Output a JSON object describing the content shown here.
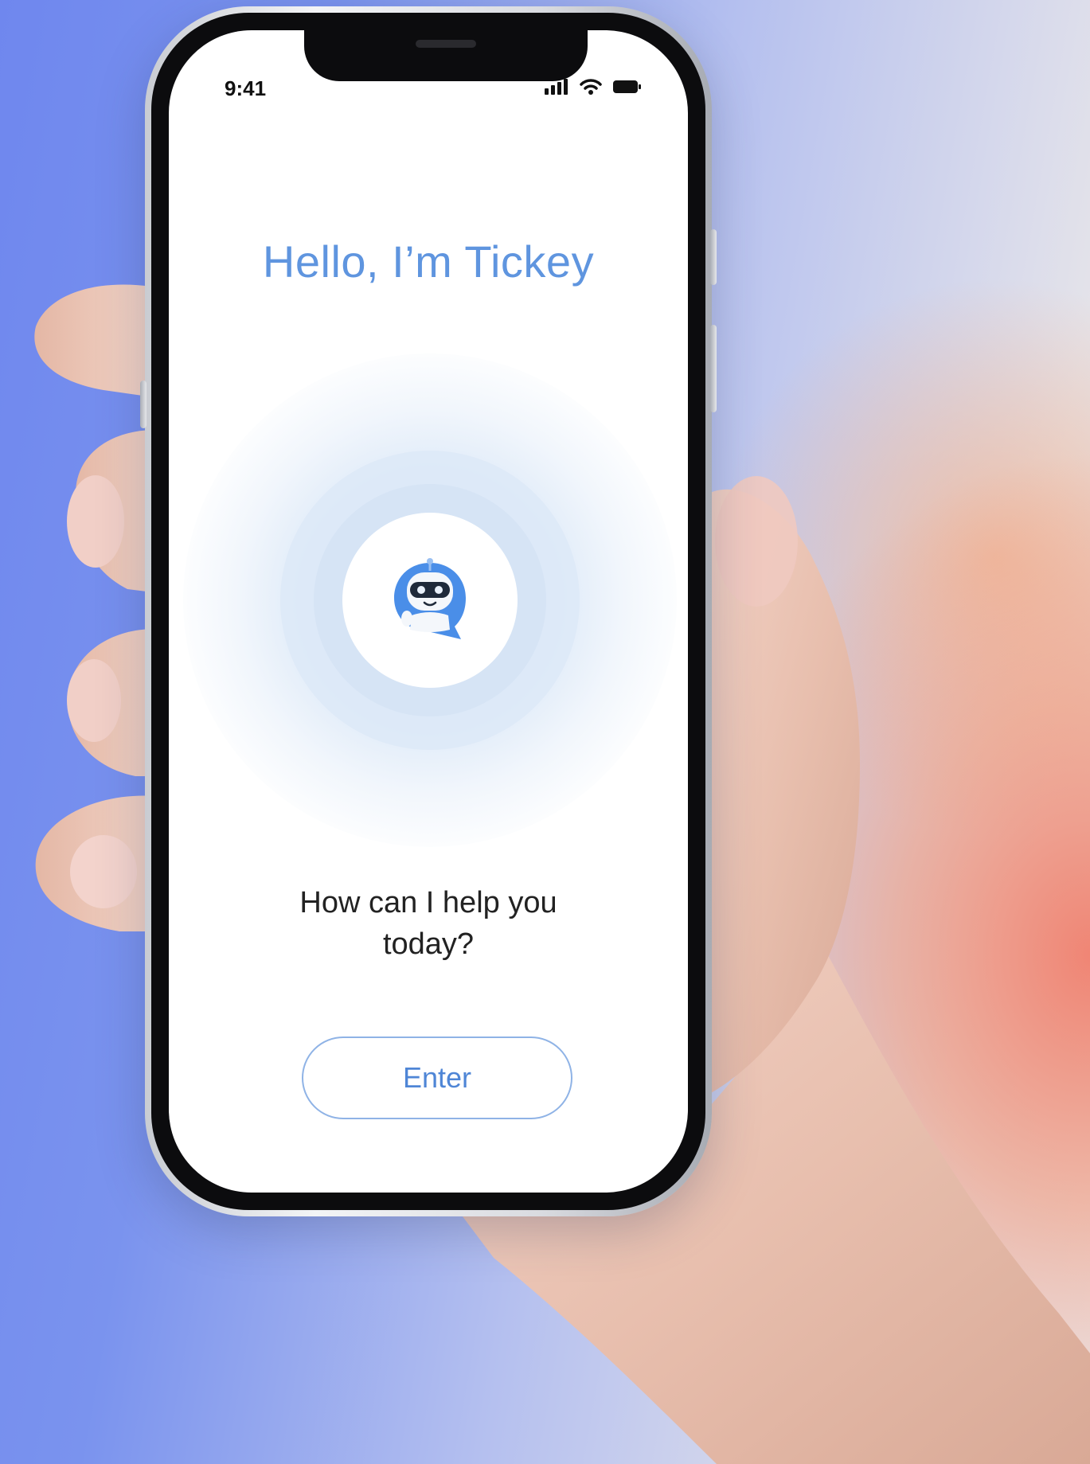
{
  "status_bar": {
    "time": "9:41",
    "icons": [
      "signal-icon",
      "wifi-icon",
      "battery-icon"
    ]
  },
  "welcome": {
    "title": "Hello, I’m Tickey",
    "prompt_line1": "How can I help you",
    "prompt_line2": "today?",
    "enter_label": "Enter"
  },
  "colors": {
    "accent": "#5f95df",
    "button_border": "#8fb3e6",
    "bot_blue": "#4a8ee8",
    "text_dark": "#222222"
  },
  "assets": {
    "avatar": "chatbot-robot-icon"
  }
}
